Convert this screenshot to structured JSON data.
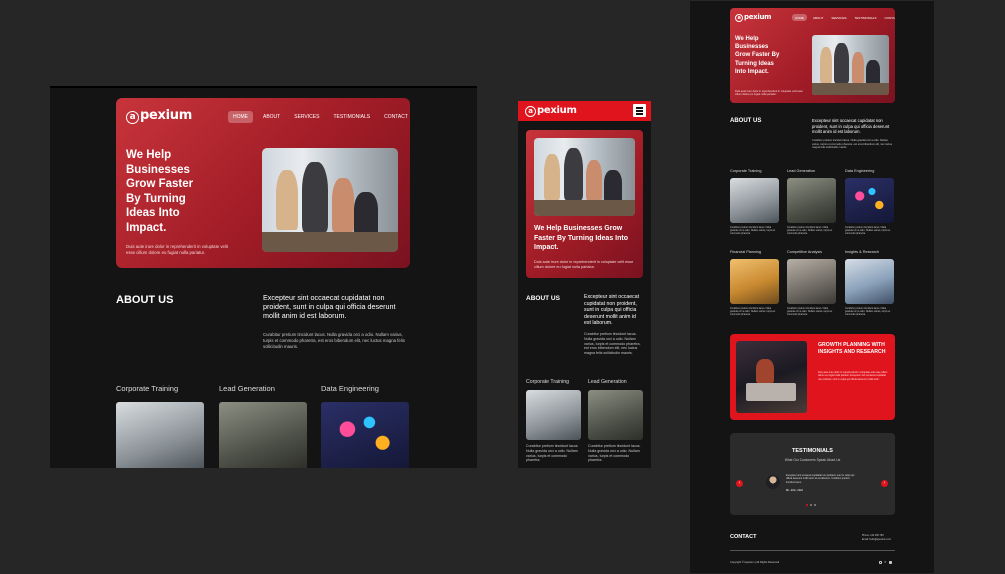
{
  "brand": {
    "logo": "pexium",
    "logo_letter": "a"
  },
  "nav": [
    {
      "label": "HOME",
      "active": true
    },
    {
      "label": "ABOUT",
      "active": false
    },
    {
      "label": "SERVICES",
      "active": false
    },
    {
      "label": "TESTIMONIALS",
      "active": false
    },
    {
      "label": "CONTACT",
      "active": false
    }
  ],
  "hero": {
    "title": "We Help Businesses Grow Faster By Turning Ideas Into Impact.",
    "text": "Duis aute irure dolor in reprehenderit in voluptate velit esse cillum dolore eu fugiat nulla pariatur."
  },
  "about": {
    "heading": "ABOUT US",
    "lead": "Excepteur sint occaecat cupidatat non proident, sunt in culpa qui officia deserunt mollit anim id est laborum.",
    "body": "Curabitur pretium tincidunt lacus. Nulla gravida orci a odio. Nullam varius, turpis et commodo pharetra, est eros bibendum elit, nec luctus magna felis sollicitudin mauris."
  },
  "services": [
    {
      "title": "Corporate Training",
      "desc": "Curabitur pretium tincidunt lacus. Nulla gravida orci a odio. Nullam varius, turpis et commodo pharetra."
    },
    {
      "title": "Lead Generation",
      "desc": "Curabitur pretium tincidunt lacus. Nulla gravida orci a odio. Nullam varius, turpis et commodo pharetra."
    },
    {
      "title": "Data Engineering",
      "desc": "Curabitur pretium tincidunt lacus. Nulla gravida orci a odio. Nullam varius, turpis et commodo pharetra."
    },
    {
      "title": "Financial Planning",
      "desc": "Curabitur pretium tincidunt lacus. Nulla gravida orci a odio. Nullam varius, turpis et commodo pharetra."
    },
    {
      "title": "Competitive Analysis",
      "desc": "Curabitur pretium tincidunt lacus. Nulla gravida orci a odio. Nullam varius, turpis et commodo pharetra."
    },
    {
      "title": "Insights & Research",
      "desc": "Curabitur pretium tincidunt lacus. Nulla gravida orci a odio. Nullam varius, turpis et commodo pharetra."
    }
  ],
  "growth": {
    "title": "GROWTH PLANNING WITH INSIGHTS AND RESEARCH",
    "text": "Duis aute irure dolor in reprehenderit in voluptate velit esse cillum dolore eu fugiat nulla pariatur. Excepteur sint occaecat cupidatat non proident, sunt in culpa qui officia deserunt mollit anim."
  },
  "testimonials": {
    "heading": "TESTIMONIALS",
    "sub": "What Our Customers Speak About Us",
    "quote": "Excepteur sint occaecat cupidatat non proident, sunt in culpa qui officia deserunt mollit anim id est laborum. Curabitur pretium tincidunt lacus.",
    "author": "Mr. John, CEO"
  },
  "contact": {
    "heading": "CONTACT",
    "phone": "Phone: 123 456 789",
    "email": "Email: hello@apexium.com",
    "copyright": "Copyright © Apexium | All Rights Reserved"
  },
  "colors": {
    "accent": "#e0141d",
    "hero_start": "#c8343b",
    "hero_end": "#7a1220",
    "bg": "#141414",
    "canvas": "#262626"
  },
  "icons": {
    "menu": "hamburger-icon",
    "prev": "chevron-left-icon",
    "next": "chevron-right-icon"
  }
}
